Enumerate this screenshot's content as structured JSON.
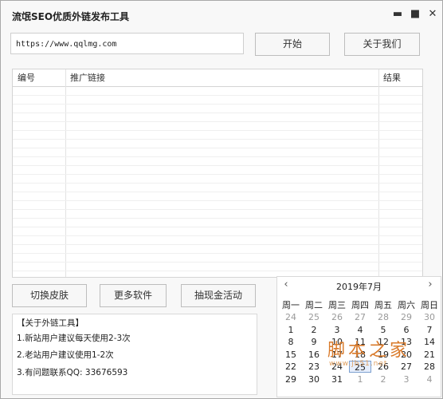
{
  "window": {
    "title": "流氓SEO优质外链发布工具"
  },
  "controls": {
    "minimize": "▬",
    "maximize": "■",
    "close": "✕"
  },
  "url_input": {
    "value": "https://www.qqlmg.com"
  },
  "buttons": {
    "start": "开始",
    "about": "关于我们",
    "skin": "切换皮肤",
    "more": "更多软件",
    "cash": "抽现金活动"
  },
  "table": {
    "columns": [
      "编号",
      "推广链接",
      "结果"
    ]
  },
  "info": {
    "lines": [
      "【关于外链工具】",
      "1.新站用户建议每天使用2-3次",
      "2.老站用户建议使用1-2次",
      "3.有问题联系QQ: 33676593"
    ]
  },
  "calendar": {
    "month": "2019年7月",
    "prev": "‹",
    "next": "›",
    "weekdays": [
      "周一",
      "周二",
      "周三",
      "周四",
      "周五",
      "周六",
      "周日"
    ],
    "rows": [
      [
        "24",
        "25",
        "26",
        "27",
        "28",
        "29",
        "30"
      ],
      [
        "1",
        "2",
        "3",
        "4",
        "5",
        "6",
        "7"
      ],
      [
        "8",
        "9",
        "10",
        "11",
        "12",
        "13",
        "14"
      ],
      [
        "15",
        "16",
        "17",
        "18",
        "19",
        "20",
        "21"
      ],
      [
        "22",
        "23",
        "24",
        "25",
        "26",
        "27",
        "28"
      ],
      [
        "29",
        "30",
        "31",
        "1",
        "2",
        "3",
        "4"
      ]
    ],
    "today": "25"
  },
  "watermark": {
    "text": "脚本之家",
    "url": "www.jb51.net"
  }
}
